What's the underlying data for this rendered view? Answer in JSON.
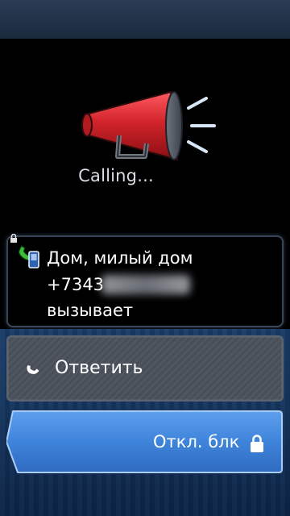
{
  "call": {
    "status_text": "Calling...",
    "caller_name": "Дом, милый дом",
    "caller_number": "+7343",
    "caller_status": "вызывает"
  },
  "actions": {
    "answer_label": "Ответить",
    "unlock_label": "Откл. блк"
  },
  "icons": {
    "megaphone": "megaphone-icon",
    "call": "incoming-call-icon",
    "answer": "phone-handset-icon",
    "lock": "lock-icon",
    "small_lock": "lock-icon"
  },
  "colors": {
    "megaphone_red": "#d0232a",
    "call_icon_green": "#3bbd3b",
    "answer_button_gray": "#4f5660",
    "unlock_blue": "#4d8ee0",
    "background_blue": "#16365f"
  }
}
